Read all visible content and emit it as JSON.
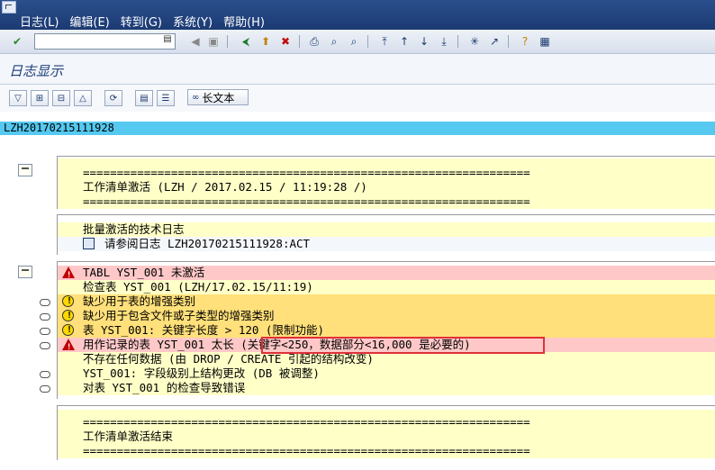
{
  "menu": [
    "日志(L)",
    "编辑(E)",
    "转到(G)",
    "系统(Y)",
    "帮助(H)"
  ],
  "toolbar": {
    "icons": [
      "check-icon",
      "save-icon",
      "back-icon",
      "exit-icon",
      "cancel-icon",
      "print-icon",
      "find-icon",
      "find-next-icon",
      "first-page-icon",
      "prev-page-icon",
      "next-page-icon",
      "last-page-icon",
      "new-session-icon",
      "shortcut-icon",
      "help-icon",
      "layout-icon"
    ]
  },
  "title": "日志显示",
  "app_toolbar": {
    "long_text": "长文本"
  },
  "log_id": "LZH20170215111928",
  "header_block": {
    "separator": "==================================================================",
    "title": "工作清单激活 (LZH / 2017.02.15 / 11:19:28 /)"
  },
  "tech_block": {
    "line1": "批量激活的技术日志",
    "line2": "请参阅日志 LZH20170215111928:ACT"
  },
  "messages": [
    {
      "type": "error",
      "text": "TABL YST_001 未激活"
    },
    {
      "type": "plain",
      "text": "检查表 YST_001 (LZH/17.02.15/11:19)"
    },
    {
      "type": "warning",
      "text": "缺少用于表的增强类别"
    },
    {
      "type": "warning",
      "text": "缺少用于包含文件或子类型的增强类别"
    },
    {
      "type": "warning",
      "text": "表 YST_001: 关键字长度 > 120 (限制功能)"
    },
    {
      "type": "error",
      "text": "用作记录的表 YST_001 太长 (关键字<250，数据部分<16,000 是必要的)"
    },
    {
      "type": "plain",
      "text": "不存在任何数据 (由 DROP / CREATE 引起的结构改变)"
    },
    {
      "type": "plain",
      "text": "YST_001: 字段级别上结构更改 (DB 被调整)"
    },
    {
      "type": "plain",
      "text": "对表 YST_001 的检查导致错误"
    }
  ],
  "footer_block": {
    "separator": "==================================================================",
    "title": "工作清单激活结束"
  }
}
